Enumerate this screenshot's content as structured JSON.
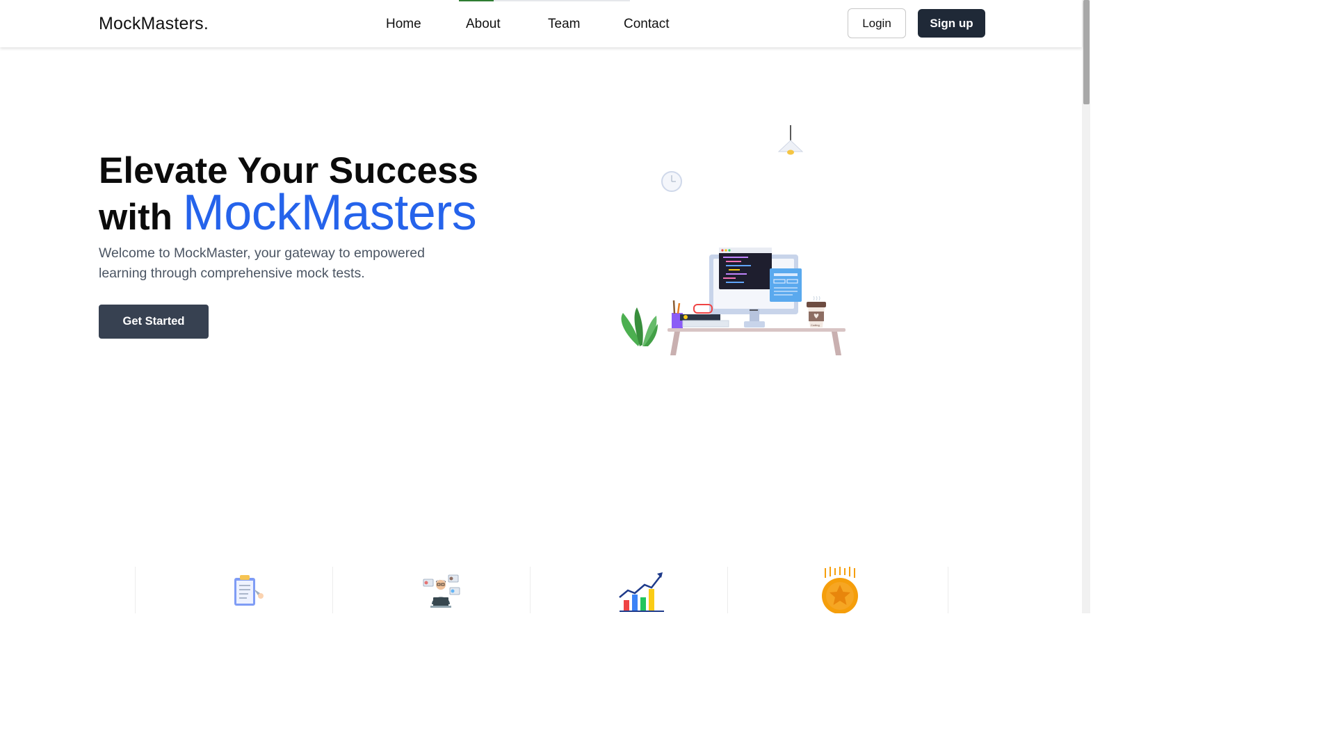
{
  "navbar": {
    "brand": "MockMasters.",
    "links": [
      {
        "label": "Home"
      },
      {
        "label": "About"
      },
      {
        "label": "Team"
      },
      {
        "label": "Contact"
      }
    ],
    "login_label": "Login",
    "signup_label": "Sign up"
  },
  "hero": {
    "title_line1": "Elevate Your Success",
    "title_prefix": "with",
    "title_accent": "MockMasters",
    "subtitle": "Welcome to MockMaster, your gateway to empowered learning through comprehensive mock tests.",
    "cta_label": "Get Started"
  },
  "illustration": {
    "items": [
      "pendant-lamp-icon",
      "wall-clock-icon",
      "desk-computer-icon",
      "plant-icon",
      "coffee-cup-icon"
    ],
    "cup_label": "Coding"
  },
  "features": [
    {
      "icon": "clipboard-checklist-icon"
    },
    {
      "icon": "developer-at-laptop-icon"
    },
    {
      "icon": "growth-chart-icon"
    },
    {
      "icon": "medal-star-icon"
    }
  ],
  "colors": {
    "accent": "#2563eb",
    "primary_dark": "#1f2937",
    "cta": "#374151",
    "nav_indicator": "#2f7d32"
  }
}
